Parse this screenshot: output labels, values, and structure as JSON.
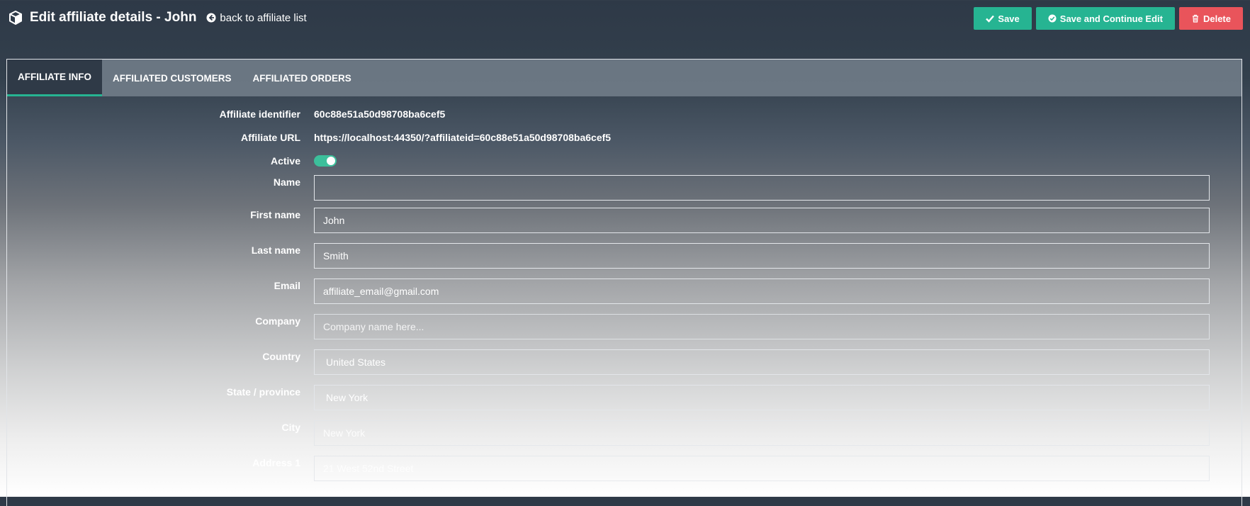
{
  "header": {
    "title": "Edit affiliate details - John",
    "back_link": "back to affiliate list"
  },
  "actions": {
    "save": "Save",
    "save_continue": "Save and Continue Edit",
    "delete": "Delete"
  },
  "tabs": [
    {
      "label": "AFFILIATE INFO",
      "active": true
    },
    {
      "label": "AFFILIATED CUSTOMERS",
      "active": false
    },
    {
      "label": "AFFILIATED ORDERS",
      "active": false
    }
  ],
  "form": {
    "identifier": {
      "label": "Affiliate identifier",
      "value": "60c88e51a50d98708ba6cef5"
    },
    "url": {
      "label": "Affiliate URL",
      "value": "https://localhost:44350/?affiliateid=60c88e51a50d98708ba6cef5"
    },
    "active": {
      "label": "Active",
      "checked": true
    },
    "name": {
      "label": "Name",
      "value": ""
    },
    "first_name": {
      "label": "First name",
      "value": "John"
    },
    "last_name": {
      "label": "Last name",
      "value": "Smith"
    },
    "email": {
      "label": "Email",
      "value": "affiliate_email@gmail.com"
    },
    "company": {
      "label": "Company",
      "placeholder": "Company name here..."
    },
    "country": {
      "label": "Country",
      "value": "United States"
    },
    "state": {
      "label": "State / province",
      "value": "New York"
    },
    "city": {
      "label": "City",
      "placeholder": "New York"
    },
    "address1": {
      "label": "Address 1",
      "placeholder": "21 West 52nd Street"
    }
  },
  "colors": {
    "accent": "#26b492",
    "danger": "#e9545b",
    "header_bg": "#2e3947"
  }
}
